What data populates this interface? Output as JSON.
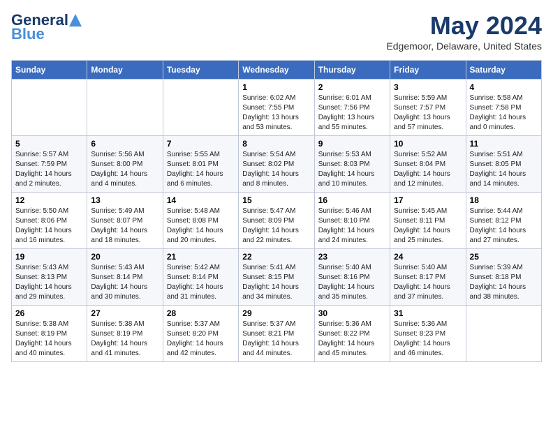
{
  "header": {
    "logo_general": "General",
    "logo_blue": "Blue",
    "month_year": "May 2024",
    "location": "Edgemoor, Delaware, United States"
  },
  "weekdays": [
    "Sunday",
    "Monday",
    "Tuesday",
    "Wednesday",
    "Thursday",
    "Friday",
    "Saturday"
  ],
  "weeks": [
    [
      {
        "day": "",
        "sunrise": "",
        "sunset": "",
        "daylight": ""
      },
      {
        "day": "",
        "sunrise": "",
        "sunset": "",
        "daylight": ""
      },
      {
        "day": "",
        "sunrise": "",
        "sunset": "",
        "daylight": ""
      },
      {
        "day": "1",
        "sunrise": "Sunrise: 6:02 AM",
        "sunset": "Sunset: 7:55 PM",
        "daylight": "Daylight: 13 hours and 53 minutes."
      },
      {
        "day": "2",
        "sunrise": "Sunrise: 6:01 AM",
        "sunset": "Sunset: 7:56 PM",
        "daylight": "Daylight: 13 hours and 55 minutes."
      },
      {
        "day": "3",
        "sunrise": "Sunrise: 5:59 AM",
        "sunset": "Sunset: 7:57 PM",
        "daylight": "Daylight: 13 hours and 57 minutes."
      },
      {
        "day": "4",
        "sunrise": "Sunrise: 5:58 AM",
        "sunset": "Sunset: 7:58 PM",
        "daylight": "Daylight: 14 hours and 0 minutes."
      }
    ],
    [
      {
        "day": "5",
        "sunrise": "Sunrise: 5:57 AM",
        "sunset": "Sunset: 7:59 PM",
        "daylight": "Daylight: 14 hours and 2 minutes."
      },
      {
        "day": "6",
        "sunrise": "Sunrise: 5:56 AM",
        "sunset": "Sunset: 8:00 PM",
        "daylight": "Daylight: 14 hours and 4 minutes."
      },
      {
        "day": "7",
        "sunrise": "Sunrise: 5:55 AM",
        "sunset": "Sunset: 8:01 PM",
        "daylight": "Daylight: 14 hours and 6 minutes."
      },
      {
        "day": "8",
        "sunrise": "Sunrise: 5:54 AM",
        "sunset": "Sunset: 8:02 PM",
        "daylight": "Daylight: 14 hours and 8 minutes."
      },
      {
        "day": "9",
        "sunrise": "Sunrise: 5:53 AM",
        "sunset": "Sunset: 8:03 PM",
        "daylight": "Daylight: 14 hours and 10 minutes."
      },
      {
        "day": "10",
        "sunrise": "Sunrise: 5:52 AM",
        "sunset": "Sunset: 8:04 PM",
        "daylight": "Daylight: 14 hours and 12 minutes."
      },
      {
        "day": "11",
        "sunrise": "Sunrise: 5:51 AM",
        "sunset": "Sunset: 8:05 PM",
        "daylight": "Daylight: 14 hours and 14 minutes."
      }
    ],
    [
      {
        "day": "12",
        "sunrise": "Sunrise: 5:50 AM",
        "sunset": "Sunset: 8:06 PM",
        "daylight": "Daylight: 14 hours and 16 minutes."
      },
      {
        "day": "13",
        "sunrise": "Sunrise: 5:49 AM",
        "sunset": "Sunset: 8:07 PM",
        "daylight": "Daylight: 14 hours and 18 minutes."
      },
      {
        "day": "14",
        "sunrise": "Sunrise: 5:48 AM",
        "sunset": "Sunset: 8:08 PM",
        "daylight": "Daylight: 14 hours and 20 minutes."
      },
      {
        "day": "15",
        "sunrise": "Sunrise: 5:47 AM",
        "sunset": "Sunset: 8:09 PM",
        "daylight": "Daylight: 14 hours and 22 minutes."
      },
      {
        "day": "16",
        "sunrise": "Sunrise: 5:46 AM",
        "sunset": "Sunset: 8:10 PM",
        "daylight": "Daylight: 14 hours and 24 minutes."
      },
      {
        "day": "17",
        "sunrise": "Sunrise: 5:45 AM",
        "sunset": "Sunset: 8:11 PM",
        "daylight": "Daylight: 14 hours and 25 minutes."
      },
      {
        "day": "18",
        "sunrise": "Sunrise: 5:44 AM",
        "sunset": "Sunset: 8:12 PM",
        "daylight": "Daylight: 14 hours and 27 minutes."
      }
    ],
    [
      {
        "day": "19",
        "sunrise": "Sunrise: 5:43 AM",
        "sunset": "Sunset: 8:13 PM",
        "daylight": "Daylight: 14 hours and 29 minutes."
      },
      {
        "day": "20",
        "sunrise": "Sunrise: 5:43 AM",
        "sunset": "Sunset: 8:14 PM",
        "daylight": "Daylight: 14 hours and 30 minutes."
      },
      {
        "day": "21",
        "sunrise": "Sunrise: 5:42 AM",
        "sunset": "Sunset: 8:14 PM",
        "daylight": "Daylight: 14 hours and 31 minutes."
      },
      {
        "day": "22",
        "sunrise": "Sunrise: 5:41 AM",
        "sunset": "Sunset: 8:15 PM",
        "daylight": "Daylight: 14 hours and 34 minutes."
      },
      {
        "day": "23",
        "sunrise": "Sunrise: 5:40 AM",
        "sunset": "Sunset: 8:16 PM",
        "daylight": "Daylight: 14 hours and 35 minutes."
      },
      {
        "day": "24",
        "sunrise": "Sunrise: 5:40 AM",
        "sunset": "Sunset: 8:17 PM",
        "daylight": "Daylight: 14 hours and 37 minutes."
      },
      {
        "day": "25",
        "sunrise": "Sunrise: 5:39 AM",
        "sunset": "Sunset: 8:18 PM",
        "daylight": "Daylight: 14 hours and 38 minutes."
      }
    ],
    [
      {
        "day": "26",
        "sunrise": "Sunrise: 5:38 AM",
        "sunset": "Sunset: 8:19 PM",
        "daylight": "Daylight: 14 hours and 40 minutes."
      },
      {
        "day": "27",
        "sunrise": "Sunrise: 5:38 AM",
        "sunset": "Sunset: 8:19 PM",
        "daylight": "Daylight: 14 hours and 41 minutes."
      },
      {
        "day": "28",
        "sunrise": "Sunrise: 5:37 AM",
        "sunset": "Sunset: 8:20 PM",
        "daylight": "Daylight: 14 hours and 42 minutes."
      },
      {
        "day": "29",
        "sunrise": "Sunrise: 5:37 AM",
        "sunset": "Sunset: 8:21 PM",
        "daylight": "Daylight: 14 hours and 44 minutes."
      },
      {
        "day": "30",
        "sunrise": "Sunrise: 5:36 AM",
        "sunset": "Sunset: 8:22 PM",
        "daylight": "Daylight: 14 hours and 45 minutes."
      },
      {
        "day": "31",
        "sunrise": "Sunrise: 5:36 AM",
        "sunset": "Sunset: 8:23 PM",
        "daylight": "Daylight: 14 hours and 46 minutes."
      },
      {
        "day": "",
        "sunrise": "",
        "sunset": "",
        "daylight": ""
      }
    ]
  ]
}
